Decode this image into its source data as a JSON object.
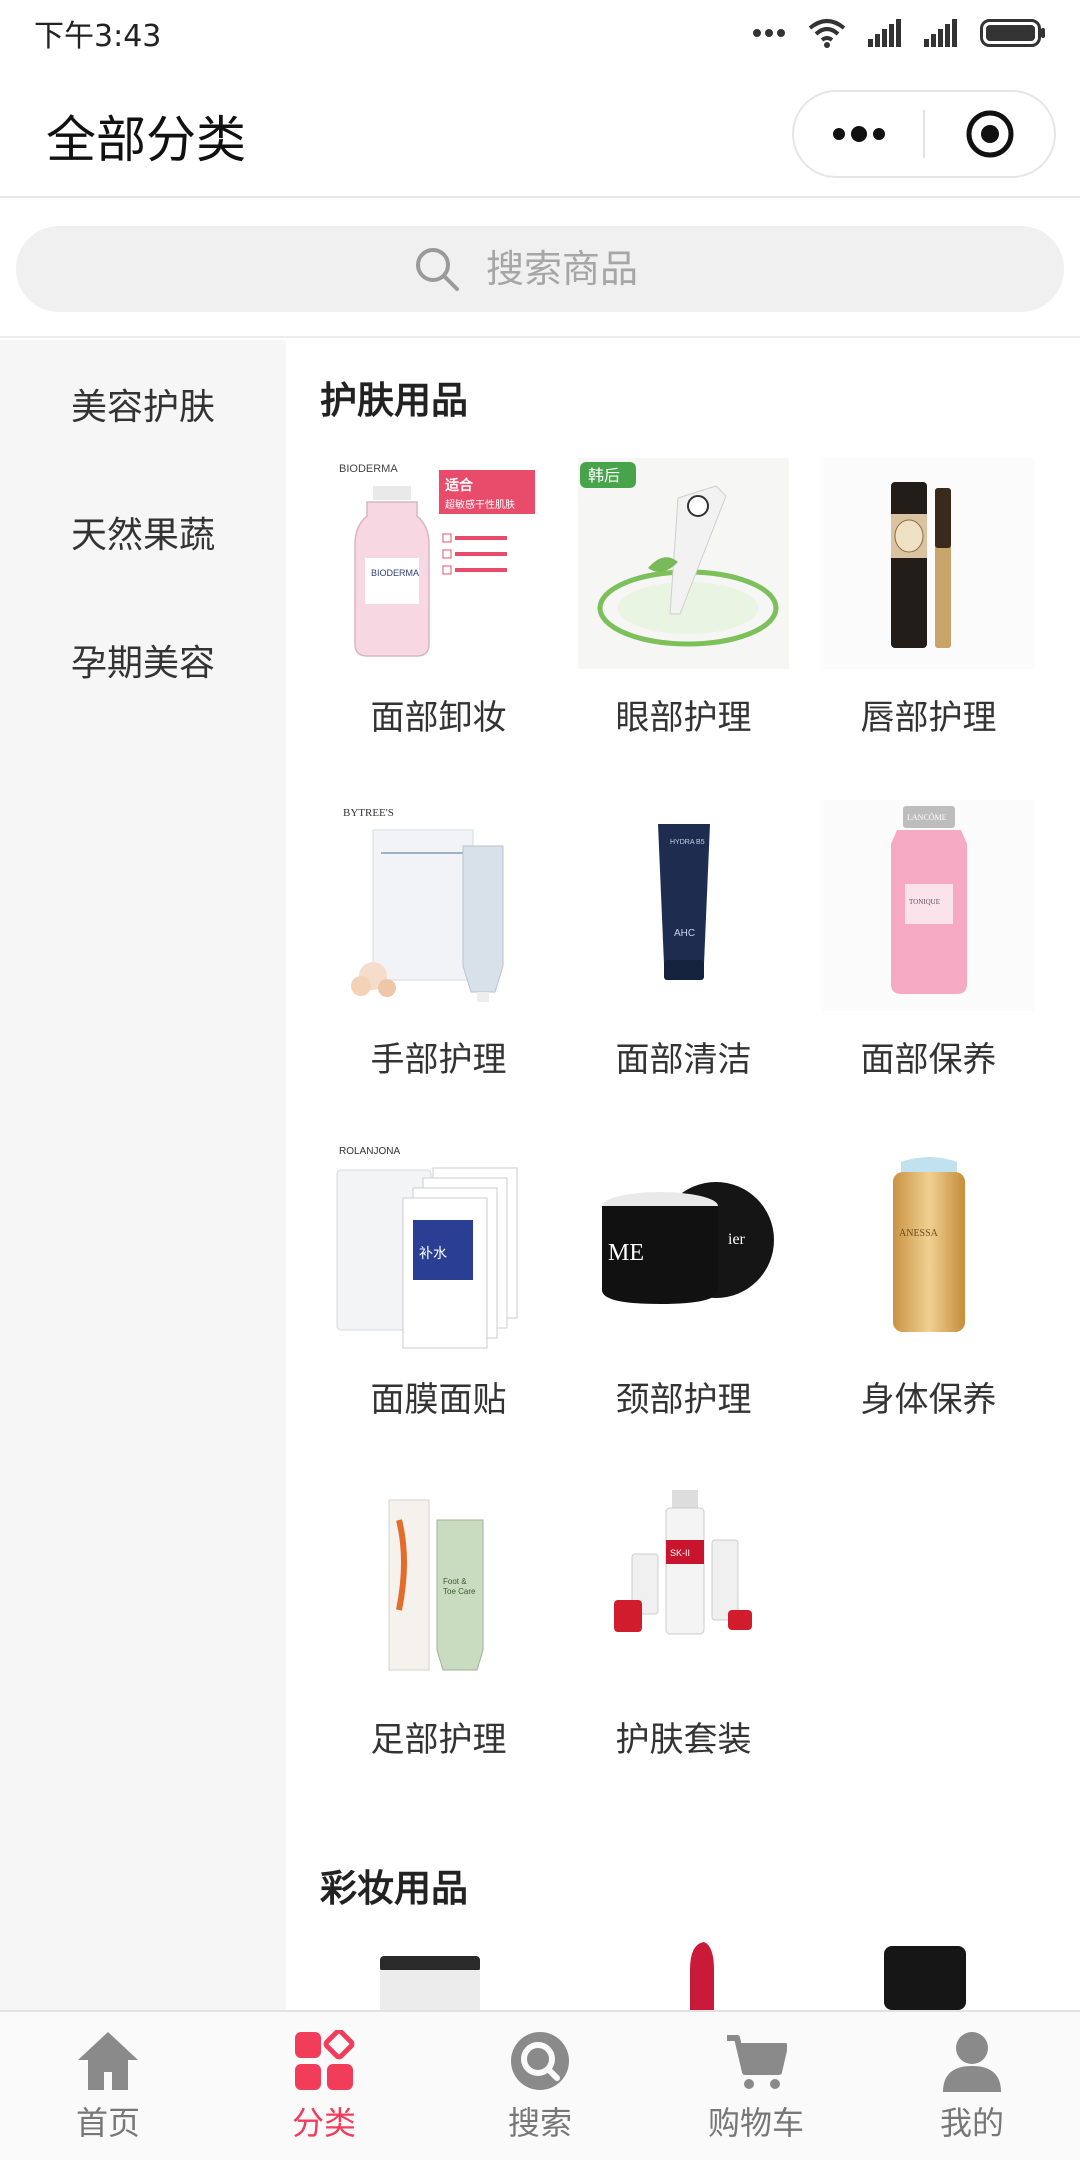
{
  "status_bar": {
    "time": "下午3:43"
  },
  "header": {
    "title": "全部分类"
  },
  "search": {
    "placeholder": "搜索商品"
  },
  "sidebar": {
    "items": [
      {
        "label": "美容护肤",
        "active": true
      },
      {
        "label": "天然果蔬",
        "active": false
      },
      {
        "label": "孕期美容",
        "active": false
      }
    ]
  },
  "sections": [
    {
      "title": "护肤用品",
      "items": [
        {
          "label": "面部卸妆",
          "image_text": "BIODERMA",
          "badge": "适合超敏感 干性肌肤使用"
        },
        {
          "label": "眼部护理",
          "image_text": "韩后"
        },
        {
          "label": "唇部护理"
        },
        {
          "label": "手部护理",
          "image_text": "BYTREE'S"
        },
        {
          "label": "面部清洁",
          "image_text": "AHC"
        },
        {
          "label": "面部保养",
          "image_text": "LANCÔME"
        },
        {
          "label": "面膜面贴",
          "image_text": "ROLANJONA"
        },
        {
          "label": "颈部护理"
        },
        {
          "label": "身体保养",
          "image_text": "ANESSA"
        },
        {
          "label": "足部护理"
        },
        {
          "label": "护肤套装",
          "image_text": "SK-II"
        }
      ]
    },
    {
      "title": "彩妆用品"
    }
  ],
  "tabbar": {
    "items": [
      {
        "label": "首页",
        "icon": "home-icon"
      },
      {
        "label": "分类",
        "icon": "category-icon",
        "active": true
      },
      {
        "label": "搜索",
        "icon": "search-icon"
      },
      {
        "label": "购物车",
        "icon": "cart-icon"
      },
      {
        "label": "我的",
        "icon": "user-icon"
      }
    ]
  },
  "colors": {
    "accent": "#f23d5a",
    "sidebar_bg": "#f6f6f6",
    "search_bg": "#f0f0f0"
  }
}
